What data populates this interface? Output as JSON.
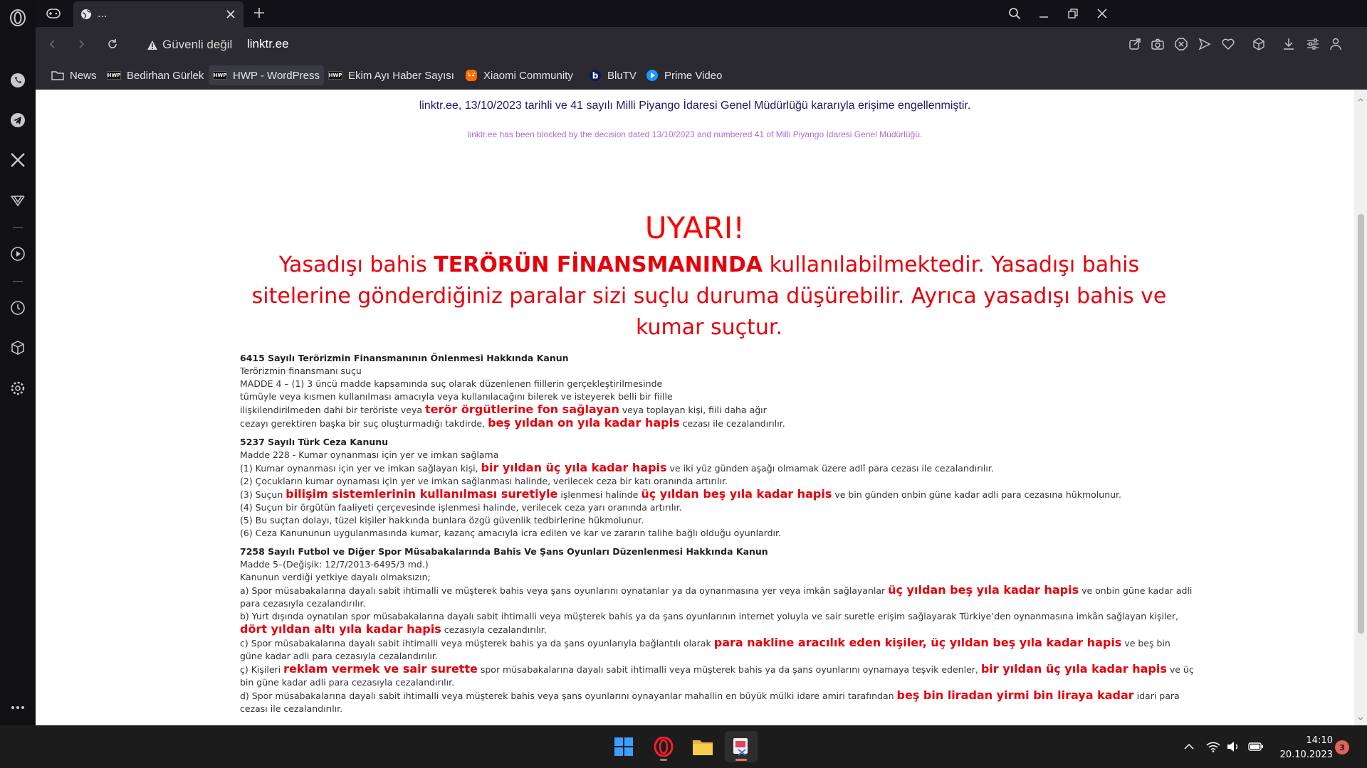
{
  "browser": {
    "tab_title": "...",
    "security_label": "Güvenli değil",
    "url": "linktr.ee"
  },
  "bookmarks": [
    {
      "label": "News",
      "icon": "folder-icon"
    },
    {
      "label": "Bedirhan Gürlek",
      "icon": "hwp-icon"
    },
    {
      "label": "HWP - WordPress",
      "icon": "hwp-icon"
    },
    {
      "label": "Ekim Ayı Haber Sayısı",
      "icon": "hwp-icon"
    },
    {
      "label": "Xiaomi Community",
      "icon": "xiaomi-icon"
    },
    {
      "label": "BluTV",
      "icon": "blutv-icon"
    },
    {
      "label": "Prime Video",
      "icon": "prime-video-icon"
    }
  ],
  "hwp_badge": "HWP",
  "page": {
    "block_notice_tr": "linktr.ee, 13/10/2023 tarihli ve 41 sayılı Milli Piyango İdaresi Genel Müdürlüğü kararıyla erişime engellenmiştir.",
    "block_notice_en": "linktr.ee has been blocked by the decision dated 13/10/2023 and numbered 41 of Milli Piyango İdaresi Genel Müdürlüğü.",
    "uyari": "UYARI!",
    "warning_1": "Yasadışı bahis ",
    "warning_bold": "TERÖRÜN FİNANSMANINDA",
    "warning_2": " kullanılabilmektedir. Yasadışı bahis sitelerine gönderdiğiniz paralar sizi suçlu duruma düşürebilir. Ayrıca yasadışı bahis ve kumar suçtur.",
    "law1": {
      "title": "6415 Sayılı Terörizmin Finansmanının Önlenmesi Hakkında Kanun",
      "l1": "Terörizmin finansmanı suçu",
      "l2": "MADDE 4 – (1) 3 üncü madde kapsamında suç olarak düzenlenen fiillerin gerçekleştirilmesinde",
      "l3": "tümüyle veya kısmen kullanılması amacıyla veya kullanılacağını bilerek ve isteyerek belli bir fiille",
      "l4a": "ilişkilendirilmeden dahi bir teröriste veya ",
      "l4r": "terör örgütlerine fon sağlayan",
      "l4b": " veya toplayan kişi, fiili daha ağır",
      "l5a": "cezayı gerektiren başka bir suç oluşturmadığı takdirde, ",
      "l5r": "beş yıldan on yıla kadar hapis",
      "l5b": " cezası ile cezalandırılır."
    },
    "law2": {
      "title": "5237 Sayılı Türk Ceza Kanunu",
      "l1": "Madde 228 - Kumar oynanması için yer ve imkan sağlama",
      "l2a": "(1) Kumar oynanması için yer ve imkan sağlayan kişi, ",
      "l2r": "bir yıldan üç yıla kadar hapis",
      "l2b": " ve iki yüz günden aşağı olmamak üzere adlî para cezası ile cezalandırılır.",
      "l3": "(2) Çocukların kumar oynaması için yer ve imkan sağlanması halinde, verilecek ceza bir katı oranında artırılır.",
      "l4a": "(3) Suçun ",
      "l4r1": "bilişim sistemlerinin kullanılması suretiyle",
      "l4b": " işlenmesi halinde ",
      "l4r2": "üç yıldan beş yıla kadar hapis",
      "l4c": " ve bin günden onbin güne kadar adli para cezasına hükmolunur.",
      "l5": "(4) Suçun bir örgütün faaliyeti çerçevesinde işlenmesi halinde, verilecek ceza yarı oranında artırılır.",
      "l6": "(5) Bu suçtan dolayı, tüzel kişiler hakkında bunlara özgü güvenlik tedbirlerine hükmolunur.",
      "l7": "(6) Ceza Kanununun uygulanmasında kumar, kazanç amacıyla icra edilen ve kar ve zararın talihe bağlı olduğu oyunlardır."
    },
    "law3": {
      "title": "7258 Sayılı Futbol ve Diğer Spor Müsabakalarında Bahis Ve Şans Oyunları Düzenlenmesi Hakkında Kanun",
      "l1": "Madde 5–(Değişik: 12/7/2013-6495/3 md.)",
      "l2": "Kanunun verdiği yetkiye dayalı olmaksızın;",
      "a1": "a) Spor müsabakalarına dayalı sabit ihtimalli ve müşterek bahis veya şans oyunlarını oynatanlar ya da oynanmasına yer veya imkân sağlayanlar ",
      "ar": "üç yıldan beş yıla kadar hapis",
      "a2": " ve onbin güne kadar adli para cezasıyla cezalandırılır.",
      "b1": "b) Yurt dışında oynatılan spor müsabakalarına dayalı sabit ihtimalli veya müşterek bahis ya da şans oyunlarının internet yoluyla ve sair suretle erişim sağlayarak Türkiye’den oynanmasına imkân sağlayan kişiler, ",
      "br": "dört yıldan altı yıla kadar hapis",
      "b2": " cezasıyla cezalandırılır.",
      "c1": "c) Spor müsabakalarına dayalı sabit ihtimalli veya müşterek bahis ya da şans oyunlarıyla bağlantılı olarak ",
      "cr": "para nakline aracılık eden kişiler, üç yıldan beş yıla kadar hapis",
      "c2": " ve beş bin güne kadar adli para cezasıyla cezalandırılır.",
      "d1": "ç) Kişileri ",
      "dr1": "reklam vermek ve sair surette",
      "d2": " spor müsabakalarına dayalı sabit ihtimalli veya müşterek bahis ya da şans oyunlarını oynamaya teşvik edenler, ",
      "dr2": "bir yıldan üç yıla kadar hapis",
      "d3": " ve üç bin güne kadar adli para cezasıyla cezalandırılır.",
      "e1": "d) Spor müsabakalarına dayalı sabit ihtimalli veya müşterek bahis veya şans oyunlarını oynayanlar mahallin en büyük mülki idare amiri tarafından ",
      "er": "beş bin liradan yirmi bin liraya kadar",
      "e2": " idari para cezası ile cezalandırılır."
    }
  },
  "taskbar": {
    "time": "14:10",
    "date": "20.10.2023",
    "notification_count": "3"
  },
  "colors": {
    "warning_red": "#e8000b",
    "notice_blue": "#1a1a6e",
    "notice_purple": "#b36ad6",
    "browser_dark": "#2a2a30"
  }
}
